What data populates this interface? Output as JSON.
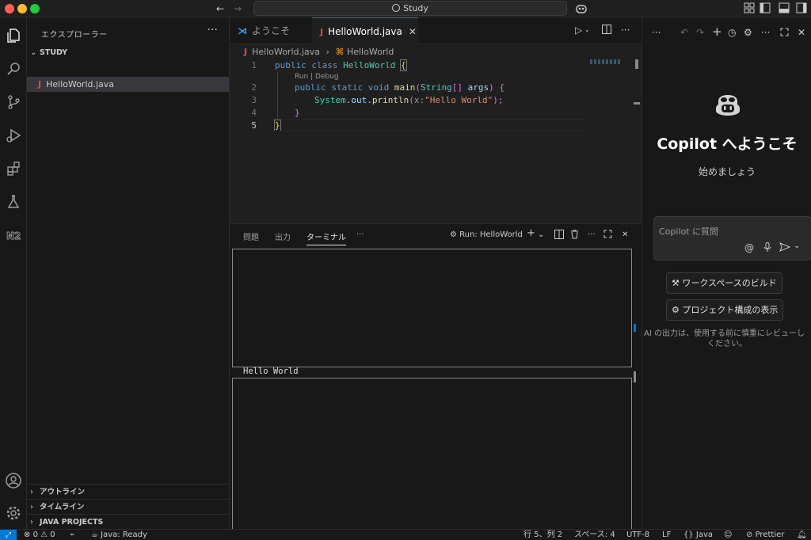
{
  "titlebar": {
    "search_label": "Study",
    "colors": {
      "close": "#ff5f57",
      "minimize": "#febc2e",
      "maximize": "#28c840"
    }
  },
  "sidebar": {
    "title": "エクスプローラー",
    "more": "···",
    "folder": "STUDY",
    "file": "HelloWorld.java",
    "sections": [
      "アウトライン",
      "タイムライン",
      "JAVA PROJECTS"
    ]
  },
  "tabs": [
    {
      "label": "ようこそ",
      "icon": "vscode-logo-icon"
    },
    {
      "label": "HelloWorld.java",
      "icon": "java-file-icon",
      "active": true
    }
  ],
  "breadcrumb": {
    "file": "HelloWorld.java",
    "symbol": "HelloWorld"
  },
  "editor": {
    "code_lens": "Run | Debug",
    "line_numbers": [
      "1",
      "2",
      "3",
      "4",
      "5"
    ],
    "lines": [
      [
        "public ",
        "class ",
        "HelloWorld ",
        "{"
      ],
      [
        "public ",
        "static ",
        "void ",
        "main",
        "(",
        "String",
        "[] ",
        "args",
        ") ",
        "{"
      ],
      [
        "System",
        ".",
        "out",
        ".",
        "println",
        "(",
        "x",
        ":",
        "\"Hello World\"",
        ");"
      ],
      [
        "}"
      ],
      [
        "}"
      ]
    ]
  },
  "panel": {
    "tabs": [
      "問題",
      "出力",
      "ターミナル"
    ],
    "active_tab": "ターミナル",
    "more": "···",
    "run_label": "Run: HelloWorld",
    "terminal_output": "Hello World"
  },
  "copilot": {
    "title": "Copilot へようこそ",
    "subtitle": "始めましょう",
    "input_placeholder": "Copilot に質問",
    "at_symbol": "@",
    "buttons": [
      "ワークスペースのビルド",
      "プロジェクト構成の表示"
    ],
    "note_line1": "AI の出力は、使用する前に慎重にレビューし",
    "note_line2": "ください。"
  },
  "statusbar": {
    "errors": "0",
    "warnings": "0",
    "java_status": "Java: Ready",
    "position": "行 5、列 2",
    "spaces": "スペース: 4",
    "encoding": "UTF-8",
    "eol": "LF",
    "language": "Java",
    "prettier": "Prettier"
  },
  "colors": {
    "accent": "#0078d4",
    "java_icon": "#e2483b",
    "keyword": "#569cd6",
    "class": "#4ec9b0",
    "string": "#ce9178"
  }
}
